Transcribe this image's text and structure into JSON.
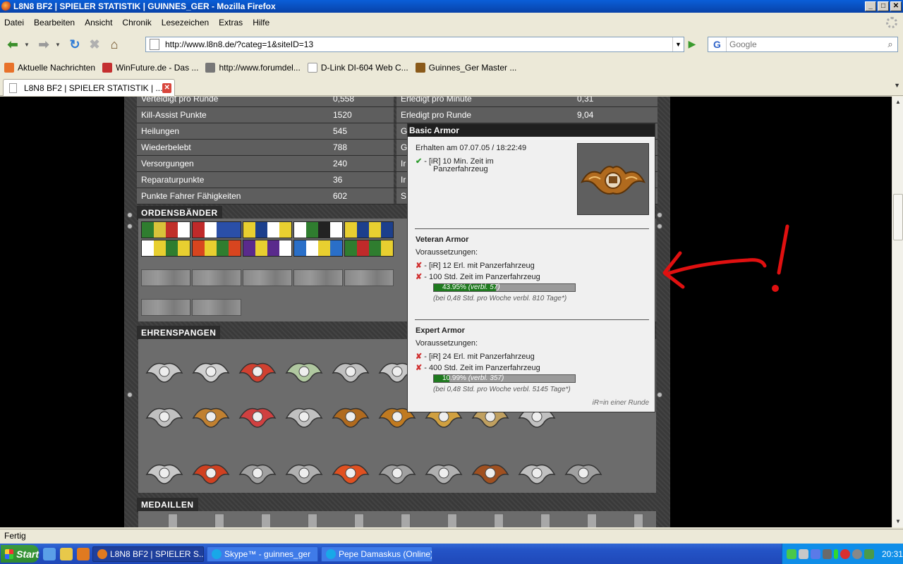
{
  "window": {
    "title": "L8N8 BF2 | SPIELER STATISTIK | GUINNES_GER - Mozilla Firefox",
    "controls": [
      "_",
      "□",
      "✕"
    ]
  },
  "menu": [
    "Datei",
    "Bearbeiten",
    "Ansicht",
    "Chronik",
    "Lesezeichen",
    "Extras",
    "Hilfe"
  ],
  "navigation": {
    "url": "http://www.l8n8.de/?categ=1&siteID=13",
    "search_placeholder": "Google",
    "search_engine_letter": "G"
  },
  "bookmarks": [
    {
      "label": "Aktuelle Nachrichten",
      "icon": "rss-icon",
      "color": "#e8722a"
    },
    {
      "label": "WinFuture.de - Das ...",
      "icon": "winfuture-icon",
      "color": "#c43030"
    },
    {
      "label": "http://www.forumdel...",
      "icon": "forum-icon",
      "color": "#777777"
    },
    {
      "label": "D-Link DI-604 Web C...",
      "icon": "page-icon",
      "color": "#ffffff"
    },
    {
      "label": "Guinnes_Ger Master ...",
      "icon": "l8n8-icon",
      "color": "#8a5a1a"
    }
  ],
  "tab": {
    "label": "L8N8 BF2 | SPIELER STATISTIK | ..."
  },
  "stats": {
    "rows": [
      {
        "label": "Verteidigt pro Runde",
        "value": "0,558",
        "label2": "Erledigt pro Minute",
        "value2": "0,31"
      },
      {
        "label": "Kill-Assist Punkte",
        "value": "1520",
        "label2": "Erledigt pro Runde",
        "value2": "9,04"
      },
      {
        "label": "Heilungen",
        "value": "545",
        "label2": "G",
        "value2": ""
      },
      {
        "label": "Wiederbelebt",
        "value": "788",
        "label2": "G",
        "value2": ""
      },
      {
        "label": "Versorgungen",
        "value": "240",
        "label2": "Ir",
        "value2": ""
      },
      {
        "label": "Reparaturpunkte",
        "value": "36",
        "label2": "Ir",
        "value2": ""
      },
      {
        "label": "Punkte Fahrer Fähigkeiten",
        "value": "602",
        "label2": "S",
        "value2": ""
      }
    ]
  },
  "sections": {
    "ribbons": "ORDENSBÄNDER",
    "badges": "EHRENSPANGEN",
    "medals": "MEDAILLEN"
  },
  "ribbon_colors": [
    [
      "#2f7d2f",
      "#d8c33a",
      "#c0302a",
      "#ffffff"
    ],
    [
      "#c02a2a",
      "#ffffff",
      "#2a4fa8",
      "#2a4fa8"
    ],
    [
      "#e8cf30",
      "#1c3f8c",
      "#ffffff",
      "#e8cf30"
    ],
    [
      "#ffffff",
      "#2f7d2f",
      "#222222",
      "#ffffff"
    ],
    [
      "#e8cf30",
      "#1c3f8c",
      "#e8cf30",
      "#1c3f8c"
    ],
    [
      "#ffffff",
      "#e8cf30",
      "#2f7d2f",
      "#e8cf30"
    ],
    [
      "#d8451f",
      "#e8cf30",
      "#2f7d2f",
      "#d8451f"
    ],
    [
      "#5a2a8c",
      "#e8cf30",
      "#5a2a8c",
      "#ffffff"
    ],
    [
      "#2a6fc8",
      "#ffffff",
      "#e8cf30",
      "#2a6fc8"
    ],
    [
      "#2f7d2f",
      "#c02a2a",
      "#2f7d2f",
      "#e8cf30"
    ]
  ],
  "tooltip": {
    "title": "Basic Armor",
    "earned": "Erhalten am 07.07.05 / 18:22:49",
    "earned_req_line1": "- [iR] 10 Min. Zeit im",
    "earned_req_line2": "Panzerfahrzeug",
    "veteran": {
      "title": "Veteran Armor",
      "prereq": "Voraussetzungen:",
      "req1": "- [iR] 12 Erl. mit Panzerfahrzeug",
      "req2": "- 100 Std. Zeit im Panzerfahrzeug",
      "progress_fraction": 0.4395,
      "progress_text": "43.95%",
      "progress_remaining": "(verbl. 57)",
      "note": "(bei 0,48 Std. pro Woche verbl. 810 Tage*)"
    },
    "expert": {
      "title": "Expert Armor",
      "prereq": "Voraussetzungen:",
      "req1": "- [iR] 24 Erl. mit Panzerfahrzeug",
      "req2": "- 400 Std. Zeit im Panzerfahrzeug",
      "progress_fraction": 0.1099,
      "progress_text": "10.99%",
      "progress_remaining": "(verbl. 357)",
      "note": "(bei 0,48 Std. pro Woche verbl. 5145 Tage*)"
    },
    "footer": "iR=in einer Runde",
    "check_glyph": "✔",
    "cross_glyph": "✘"
  },
  "status": "Fertig",
  "taskbar": {
    "start": "Start",
    "tasks": [
      {
        "label": "L8N8 BF2 | SPIELER S...",
        "active": true,
        "icon_color": "#e07a20"
      },
      {
        "label": "Skype™ - guinnes_ger",
        "active": false,
        "icon_color": "#19a8e8"
      },
      {
        "label": "Pepe Damaskus (Online) ...",
        "active": false,
        "icon_color": "#19a8e8"
      }
    ],
    "clock": "20:31"
  }
}
